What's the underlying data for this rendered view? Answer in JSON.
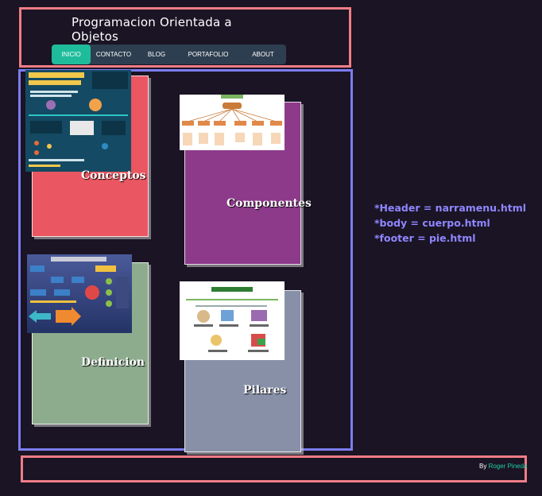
{
  "header": {
    "title": "Programacion Orientada a Objetos",
    "nav": [
      {
        "label": "INICIO",
        "active": true
      },
      {
        "label": "CONTACTO",
        "active": false
      },
      {
        "label": "BLOG",
        "active": false
      },
      {
        "label": "PORTAFOLIO",
        "active": false
      },
      {
        "label": "ABOUT",
        "active": false
      }
    ],
    "nav_color": "#2d3e50",
    "nav_active_color": "#1fbc9c",
    "border_color": "#f07d86"
  },
  "main": {
    "border_color": "#7c7df2",
    "cards": [
      {
        "label": "Conceptos",
        "color": "#ea5661",
        "image_icon": "poo-infographic-image"
      },
      {
        "label": "Componentes",
        "color": "#8d3a8a",
        "image_icon": "concept-map-image"
      },
      {
        "label": "Definicion",
        "color": "#8dac8e",
        "image_icon": "definition-diagram-image"
      },
      {
        "label": "Pilares",
        "color": "#8890a8",
        "image_icon": "pillars-image"
      }
    ]
  },
  "notes": [
    "*Header = narramenu.html",
    "*body = cuerpo.html",
    "*footer = pie.html"
  ],
  "footer": {
    "by": "By",
    "author": "Roger Pineda"
  }
}
